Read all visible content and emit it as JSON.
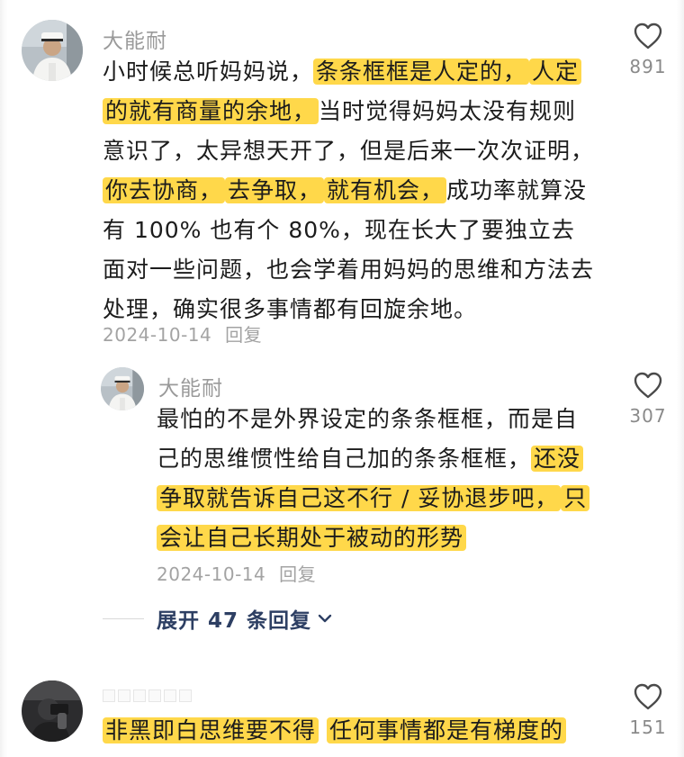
{
  "comments": [
    {
      "username": "大能耐",
      "text_segments": [
        {
          "text": "小时候总听妈妈说，",
          "hl": false
        },
        {
          "text": "条条框框是人定的，",
          "hl": true
        },
        {
          "text": "人定的就有商量的余地，",
          "hl": true
        },
        {
          "text": "当时觉得妈妈太没有规则意识了，太异想天开了，但是后来一次次证明，",
          "hl": false
        },
        {
          "text": "你去协商，",
          "hl": true
        },
        {
          "text": "去争取，",
          "hl": true
        },
        {
          "text": "就有机会，",
          "hl": true
        },
        {
          "text": "成功率就算没有 100% 也有个 80%，现在长大了要独立去面对一些问题，也会学着用妈妈的思维和方法去处理，确实很多事情都有回旋余地。",
          "hl": false
        }
      ],
      "date": "2024-10-14",
      "reply_label": "回复",
      "likes": "891"
    },
    {
      "username": "大能耐",
      "text_segments": [
        {
          "text": "最怕的不是外界设定的条条框框，而是自己的思维惯性给自己加的条条框框，",
          "hl": false
        },
        {
          "text": "还没争取就告诉自己这不行 / 妥协退步吧，",
          "hl": true
        },
        {
          "text": "只会让自己长期处于被动的形势",
          "hl": true
        }
      ],
      "date": "2024-10-14",
      "reply_label": "回复",
      "likes": "307"
    },
    {
      "username": "",
      "text_segments": [
        {
          "text": "非黑即白思维要不得",
          "hl": true
        },
        {
          "text": " ",
          "hl": false
        },
        {
          "text": "任何事情都是有梯度的",
          "hl": true
        }
      ],
      "likes": "151"
    }
  ],
  "expand_replies": "展开 47 条回复",
  "colors": {
    "highlight": "#ffd84a",
    "link": "#2d3f63",
    "meta": "#a3a3a3"
  },
  "icons": {
    "like": "heart-outline-icon",
    "expand": "chevron-down-icon"
  }
}
